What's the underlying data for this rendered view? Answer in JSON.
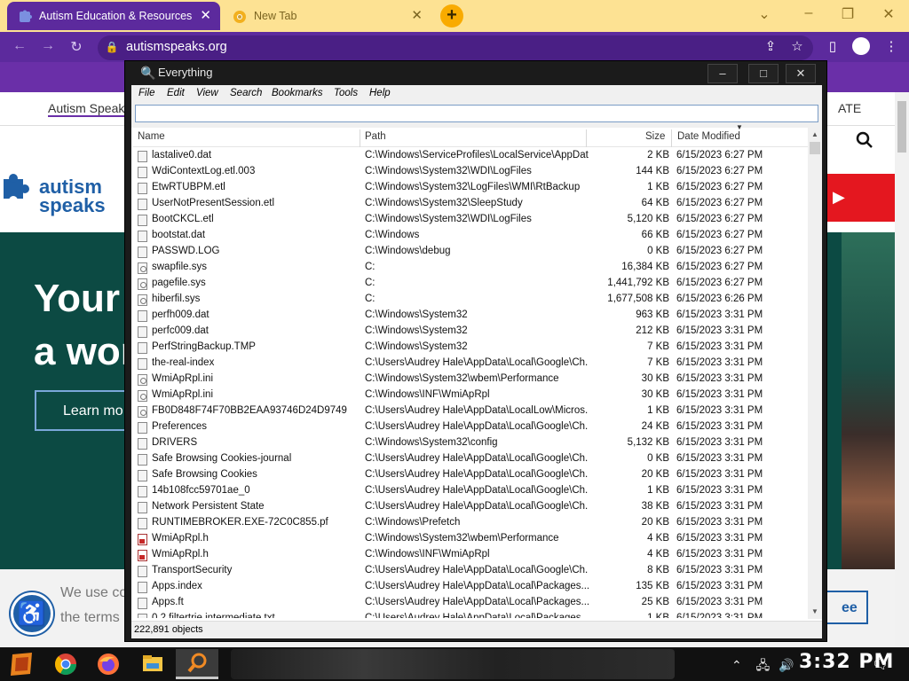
{
  "browser": {
    "tabs": [
      {
        "label": "Autism Education & Resources",
        "active": true
      },
      {
        "label": "New Tab",
        "active": false
      }
    ],
    "new_tab_label": "+",
    "url": "autismspeaks.org",
    "window_controls": {
      "minimize": "–",
      "maximize": "❐",
      "close": "✕"
    },
    "accent_color": "#5c2a9d",
    "tabstrip_color": "#fde293"
  },
  "site": {
    "nav_link": "Autism Speak",
    "nav_right": "ATE",
    "logo_line1": "autism",
    "logo_line2": "speaks",
    "donate_arrow": "▶",
    "hero_line1": "Your",
    "hero_line2": "a wor",
    "learn_button": "Learn mo",
    "cookie_line1": "We use co",
    "cookie_line2": "the terms",
    "agree_button": "ee"
  },
  "everything": {
    "title": "Everything",
    "menu": [
      "File",
      "Edit",
      "View",
      "Search",
      "Bookmarks",
      "Tools",
      "Help"
    ],
    "search_value": "",
    "columns": {
      "name": "Name",
      "path": "Path",
      "size": "Size",
      "date": "Date Modified"
    },
    "status": "222,891 objects",
    "rows": [
      {
        "name": "lastalive0.dat",
        "path": "C:\\Windows\\ServiceProfiles\\LocalService\\AppDat...",
        "size": "2 KB",
        "date": "6/15/2023 6:27 PM",
        "icon": "file"
      },
      {
        "name": "WdiContextLog.etl.003",
        "path": "C:\\Windows\\System32\\WDI\\LogFiles",
        "size": "144 KB",
        "date": "6/15/2023 6:27 PM",
        "icon": "file"
      },
      {
        "name": "EtwRTUBPM.etl",
        "path": "C:\\Windows\\System32\\LogFiles\\WMI\\RtBackup",
        "size": "1 KB",
        "date": "6/15/2023 6:27 PM",
        "icon": "file"
      },
      {
        "name": "UserNotPresentSession.etl",
        "path": "C:\\Windows\\System32\\SleepStudy",
        "size": "64 KB",
        "date": "6/15/2023 6:27 PM",
        "icon": "file"
      },
      {
        "name": "BootCKCL.etl",
        "path": "C:\\Windows\\System32\\WDI\\LogFiles",
        "size": "5,120 KB",
        "date": "6/15/2023 6:27 PM",
        "icon": "file"
      },
      {
        "name": "bootstat.dat",
        "path": "C:\\Windows",
        "size": "66 KB",
        "date": "6/15/2023 6:27 PM",
        "icon": "file"
      },
      {
        "name": "PASSWD.LOG",
        "path": "C:\\Windows\\debug",
        "size": "0 KB",
        "date": "6/15/2023 6:27 PM",
        "icon": "file"
      },
      {
        "name": "swapfile.sys",
        "path": "C:",
        "size": "16,384 KB",
        "date": "6/15/2023 6:27 PM",
        "icon": "cog"
      },
      {
        "name": "pagefile.sys",
        "path": "C:",
        "size": "1,441,792 KB",
        "date": "6/15/2023 6:27 PM",
        "icon": "cog"
      },
      {
        "name": "hiberfil.sys",
        "path": "C:",
        "size": "1,677,508 KB",
        "date": "6/15/2023 6:26 PM",
        "icon": "cog"
      },
      {
        "name": "perfh009.dat",
        "path": "C:\\Windows\\System32",
        "size": "963 KB",
        "date": "6/15/2023 3:31 PM",
        "icon": "file"
      },
      {
        "name": "perfc009.dat",
        "path": "C:\\Windows\\System32",
        "size": "212 KB",
        "date": "6/15/2023 3:31 PM",
        "icon": "file"
      },
      {
        "name": "PerfStringBackup.TMP",
        "path": "C:\\Windows\\System32",
        "size": "7 KB",
        "date": "6/15/2023 3:31 PM",
        "icon": "file"
      },
      {
        "name": "the-real-index",
        "path": "C:\\Users\\Audrey Hale\\AppData\\Local\\Google\\Ch...",
        "size": "7 KB",
        "date": "6/15/2023 3:31 PM",
        "icon": "file"
      },
      {
        "name": "WmiApRpl.ini",
        "path": "C:\\Windows\\System32\\wbem\\Performance",
        "size": "30 KB",
        "date": "6/15/2023 3:31 PM",
        "icon": "cog"
      },
      {
        "name": "WmiApRpl.ini",
        "path": "C:\\Windows\\INF\\WmiApRpl",
        "size": "30 KB",
        "date": "6/15/2023 3:31 PM",
        "icon": "cog"
      },
      {
        "name": "FB0D848F74F70BB2EAA93746D24D9749",
        "path": "C:\\Users\\Audrey Hale\\AppData\\LocalLow\\Micros...",
        "size": "1 KB",
        "date": "6/15/2023 3:31 PM",
        "icon": "cog"
      },
      {
        "name": "Preferences",
        "path": "C:\\Users\\Audrey Hale\\AppData\\Local\\Google\\Ch...",
        "size": "24 KB",
        "date": "6/15/2023 3:31 PM",
        "icon": "file"
      },
      {
        "name": "DRIVERS",
        "path": "C:\\Windows\\System32\\config",
        "size": "5,132 KB",
        "date": "6/15/2023 3:31 PM",
        "icon": "file"
      },
      {
        "name": "Safe Browsing Cookies-journal",
        "path": "C:\\Users\\Audrey Hale\\AppData\\Local\\Google\\Ch...",
        "size": "0 KB",
        "date": "6/15/2023 3:31 PM",
        "icon": "file"
      },
      {
        "name": "Safe Browsing Cookies",
        "path": "C:\\Users\\Audrey Hale\\AppData\\Local\\Google\\Ch...",
        "size": "20 KB",
        "date": "6/15/2023 3:31 PM",
        "icon": "file"
      },
      {
        "name": "14b108fcc59701ae_0",
        "path": "C:\\Users\\Audrey Hale\\AppData\\Local\\Google\\Ch...",
        "size": "1 KB",
        "date": "6/15/2023 3:31 PM",
        "icon": "file"
      },
      {
        "name": "Network Persistent State",
        "path": "C:\\Users\\Audrey Hale\\AppData\\Local\\Google\\Ch...",
        "size": "38 KB",
        "date": "6/15/2023 3:31 PM",
        "icon": "file"
      },
      {
        "name": "RUNTIMEBROKER.EXE-72C0C855.pf",
        "path": "C:\\Windows\\Prefetch",
        "size": "20 KB",
        "date": "6/15/2023 3:31 PM",
        "icon": "file"
      },
      {
        "name": "WmiApRpl.h",
        "path": "C:\\Windows\\System32\\wbem\\Performance",
        "size": "4 KB",
        "date": "6/15/2023 3:31 PM",
        "icon": "red"
      },
      {
        "name": "WmiApRpl.h",
        "path": "C:\\Windows\\INF\\WmiApRpl",
        "size": "4 KB",
        "date": "6/15/2023 3:31 PM",
        "icon": "red"
      },
      {
        "name": "TransportSecurity",
        "path": "C:\\Users\\Audrey Hale\\AppData\\Local\\Google\\Ch...",
        "size": "8 KB",
        "date": "6/15/2023 3:31 PM",
        "icon": "file"
      },
      {
        "name": "Apps.index",
        "path": "C:\\Users\\Audrey Hale\\AppData\\Local\\Packages...",
        "size": "135 KB",
        "date": "6/15/2023 3:31 PM",
        "icon": "file"
      },
      {
        "name": "Apps.ft",
        "path": "C:\\Users\\Audrey Hale\\AppData\\Local\\Packages...",
        "size": "25 KB",
        "date": "6/15/2023 3:31 PM",
        "icon": "file"
      },
      {
        "name": "0.2.filtertrie.intermediate.txt",
        "path": "C:\\Users\\Audrey Hale\\AppData\\Local\\Packages...",
        "size": "1 KB",
        "date": "6/15/2023 3:31 PM",
        "icon": "file"
      }
    ]
  },
  "taskbar": {
    "clock": "3:32 PM",
    "apps": [
      "start-icon",
      "chrome-icon",
      "firefox-icon",
      "file-explorer-icon",
      "everything-icon"
    ]
  }
}
